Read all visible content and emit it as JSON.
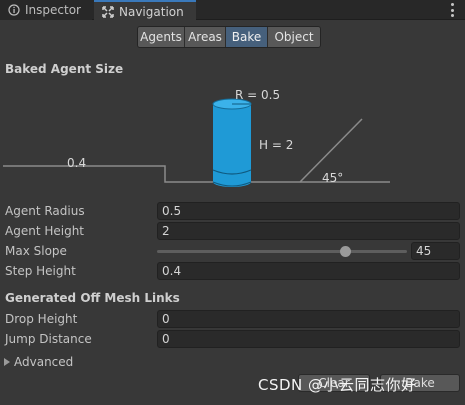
{
  "tabs": [
    {
      "label": "Inspector",
      "icon": "info-icon"
    },
    {
      "label": "Navigation",
      "icon": "navigation-icon",
      "active": true
    }
  ],
  "modes": [
    {
      "label": "Agents"
    },
    {
      "label": "Areas"
    },
    {
      "label": "Bake",
      "selected": true
    },
    {
      "label": "Object"
    }
  ],
  "baked_agent_size": {
    "title": "Baked Agent Size",
    "radius_label": "R = 0.5",
    "height_label": "H = 2",
    "step_label": "0.4",
    "slope_label": "45°"
  },
  "properties": [
    {
      "label": "Agent Radius",
      "value": "0.5"
    },
    {
      "label": "Agent Height",
      "value": "2"
    },
    {
      "label": "Max Slope",
      "value": "45",
      "slider_fraction": 0.75
    },
    {
      "label": "Step Height",
      "value": "0.4"
    }
  ],
  "offmesh": {
    "title": "Generated Off Mesh Links",
    "fields": [
      {
        "label": "Drop Height",
        "value": "0"
      },
      {
        "label": "Jump Distance",
        "value": "0"
      }
    ]
  },
  "advanced_label": "Advanced",
  "buttons": {
    "clear": "Clear",
    "bake": "Bake"
  },
  "watermark": "CSDN @小云同志你好",
  "colors": {
    "accent": "#3a79bb",
    "cylinder": "#1f9ad6",
    "selected_mode": "#46607c"
  }
}
